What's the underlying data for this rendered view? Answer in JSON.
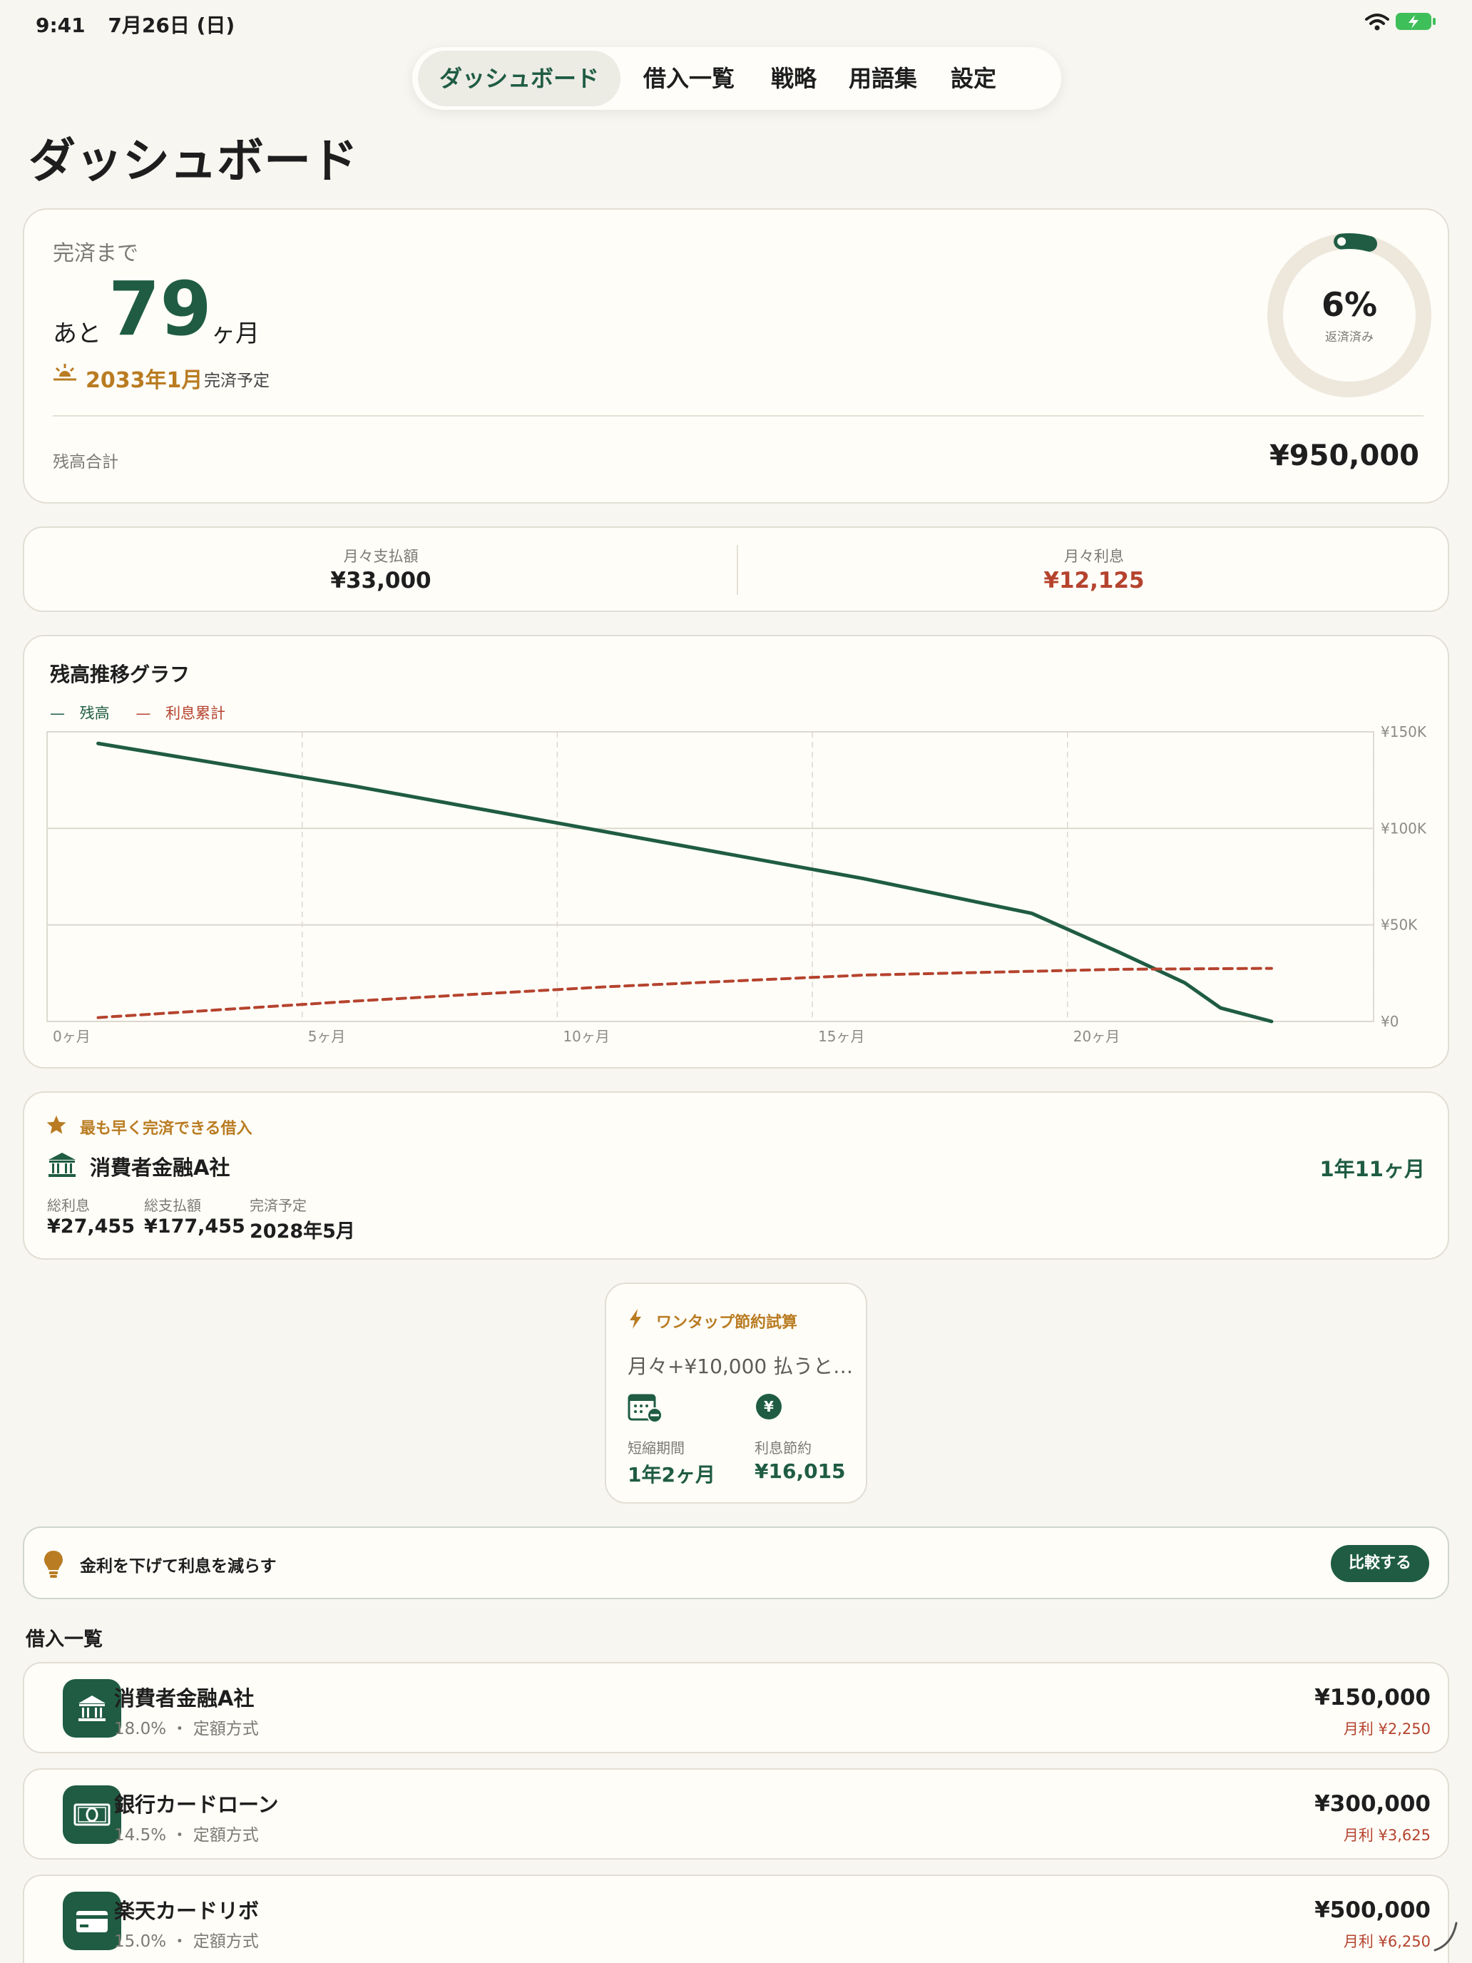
{
  "status_bar": {
    "time": "9:41",
    "date": "7月26日 (日)"
  },
  "tabs": [
    {
      "label": "ダッシュボード",
      "active": true
    },
    {
      "label": "借入一覧"
    },
    {
      "label": "戦略"
    },
    {
      "label": "用語集"
    },
    {
      "label": "設定"
    }
  ],
  "page_title": "ダッシュボード",
  "summary": {
    "until_label": "完済まで",
    "prefix": "あと",
    "months": "79",
    "suffix": "ヶ月",
    "payoff_date": "2033年1月",
    "payoff_suffix": "完済予定",
    "progress_percent": "6%",
    "progress_value": 0.06,
    "progress_label": "返済済み",
    "balance_label": "残高合計",
    "balance_value": "¥950,000"
  },
  "stats": {
    "monthly_payment_label": "月々支払額",
    "monthly_payment_value": "¥33,000",
    "monthly_interest_label": "月々利息",
    "monthly_interest_value": "¥12,125"
  },
  "graph": {
    "title": "残高推移グラフ",
    "legend_balance": "残高",
    "legend_interest": "利息累計"
  },
  "chart_data": {
    "type": "line",
    "title": "残高推移グラフ",
    "xlabel": "",
    "ylabel": "",
    "x_tick_labels": [
      "0ヶ月",
      "5ヶ月",
      "10ヶ月",
      "15ヶ月",
      "20ヶ月"
    ],
    "y_tick_labels": [
      "¥150K",
      "¥100K",
      "¥50K",
      "¥0"
    ],
    "xlim": [
      -1,
      25
    ],
    "ylim": [
      0,
      150000
    ],
    "grid": true,
    "legend": "top-left",
    "colors": {
      "balance": "#1f5c43",
      "interest": "#b5432e"
    },
    "series": [
      {
        "name": "残高",
        "style": "solid",
        "x": [
          0,
          5,
          10,
          15,
          18.3,
          20,
          21.3,
          22,
          23
        ],
        "y": [
          144000,
          122000,
          98000,
          74000,
          56000,
          36000,
          20000,
          7000,
          0
        ]
      },
      {
        "name": "利息累計",
        "style": "dashed",
        "x": [
          0,
          5,
          10,
          15,
          20,
          23
        ],
        "y": [
          2000,
          10500,
          18000,
          24000,
          27000,
          27500
        ]
      }
    ]
  },
  "earliest": {
    "badge": "最も早く完済できる借入",
    "name": "消費者金融A社",
    "duration": "1年11ヶ月",
    "interest_label": "総利息",
    "interest_value": "¥27,455",
    "total_label": "総支払額",
    "total_value": "¥177,455",
    "date_label": "完済予定",
    "date_value": "2028年5月"
  },
  "simulation": {
    "title": "ワンタップ節約試算",
    "subtitle": "月々+¥10,000 払うと…",
    "shorten_label": "短縮期間",
    "shorten_value": "1年2ヶ月",
    "save_label": "利息節約",
    "save_value": "¥16,015"
  },
  "tip": {
    "text": "金利を下げて利息を減らす",
    "button": "比較する"
  },
  "loans_title": "借入一覧",
  "loans": [
    {
      "name": "消費者金融A社",
      "rate": "18.0%",
      "method": "定額方式",
      "balance": "¥150,000",
      "interest": "月利 ¥2,250",
      "icon": "bank-icon"
    },
    {
      "name": "銀行カードローン",
      "rate": "14.5%",
      "method": "定額方式",
      "balance": "¥300,000",
      "interest": "月利 ¥3,625",
      "icon": "banknote-icon"
    },
    {
      "name": "楽天カードリボ",
      "rate": "15.0%",
      "method": "定額方式",
      "balance": "¥500,000",
      "interest": "月利 ¥6,250",
      "icon": "credit-card-icon"
    }
  ]
}
